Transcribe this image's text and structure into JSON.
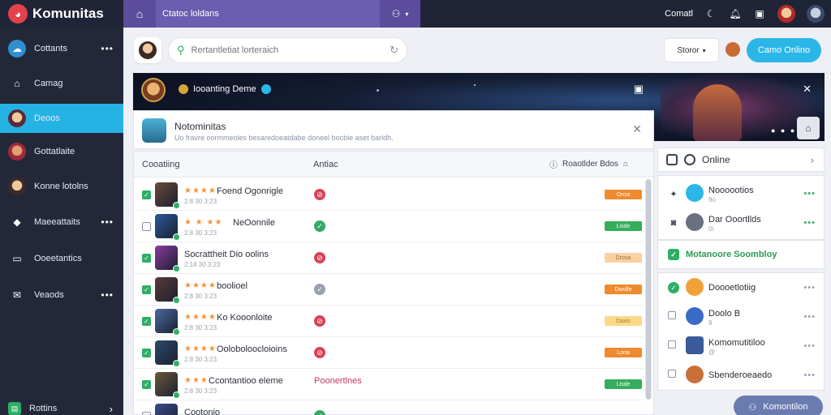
{
  "app": {
    "brand": "Komunitas"
  },
  "topbar": {
    "breadcrumb": "Ctatoc loldans",
    "right_label": "Comatl"
  },
  "sidebar": {
    "items": [
      {
        "label": "Cottants",
        "icon": "community-icon",
        "more": true
      },
      {
        "label": "Camag",
        "icon": "home-icon",
        "more": false
      },
      {
        "label": "Deoos",
        "icon": "user-avatar-icon",
        "more": false,
        "active": true
      },
      {
        "label": "Gottatlaite",
        "icon": "game-avatar-icon",
        "more": false
      },
      {
        "label": "Konne lotolns",
        "icon": "profile-icon",
        "more": false
      },
      {
        "label": "Maeeattaits",
        "icon": "gamepad-icon",
        "more": true
      },
      {
        "label": "Ooeetantics",
        "icon": "chat-icon",
        "more": false
      },
      {
        "label": "Veaods",
        "icon": "mail-icon",
        "more": true
      }
    ],
    "footer_label": "Rottins"
  },
  "search": {
    "placeholder": "Rertantletiat lorteraich"
  },
  "status_select": {
    "value": "Storor"
  },
  "cta_label": "Camo Onlino",
  "banner": {
    "title": "Iooanting Deme"
  },
  "notice": {
    "title": "Notominitas",
    "subtitle": "Uo fravre oormmeoles besaredoeatdabe doneel bocbie aset barldh."
  },
  "table": {
    "headers": {
      "col1": "Cooatiing",
      "col2": "Antiac",
      "col3": "Roaotlder Bdos"
    },
    "rows": [
      {
        "checked": true,
        "stars": "★★★★",
        "title": "Foend Ogonrigle",
        "sub": "2:8 30 3:23",
        "action": "red",
        "tag": "Orcia",
        "tag_color": "orange",
        "thumb": "#6a4a3a"
      },
      {
        "checked": false,
        "stars": "★ ★ ★★",
        "title": "NeOonnile",
        "sub": "2:8 30 3:23",
        "action": "green",
        "tag": "Lisde",
        "tag_color": "green",
        "thumb": "#2a5a9a"
      },
      {
        "checked": true,
        "stars": "",
        "title": "Socrattheit Dio oolins",
        "sub": "2:18 30 3:23",
        "action": "red",
        "tag": "Drosa",
        "tag_color": "peach",
        "thumb": "#8a3aa0"
      },
      {
        "checked": true,
        "stars": "★★★★",
        "title": "boolioel",
        "sub": "2:8 30 3:23",
        "action": "gray",
        "tag": "Dwolle",
        "tag_color": "orange",
        "thumb": "#5a3a3a"
      },
      {
        "checked": true,
        "stars": "★★★★",
        "title": "Ko Kooonloite",
        "sub": "2:8 30 3:23",
        "action": "red",
        "tag": "Daxio",
        "tag_color": "yellow",
        "thumb": "#4a6aa0"
      },
      {
        "checked": true,
        "stars": "★★★★",
        "title": "Ooloboloocloioins",
        "sub": "2:8 30 3:23",
        "action": "red",
        "tag": "Loria",
        "tag_color": "orange",
        "thumb": "#2a4a6a"
      },
      {
        "checked": true,
        "stars": "★★★",
        "title": "Ccontantioo eleme",
        "sub": "2:8 30 3:23",
        "action": "green",
        "tag": "Lisde",
        "tag_color": "green",
        "thumb": "#6a5a3a",
        "extra": "Poonertlnes"
      },
      {
        "checked": false,
        "stars": "",
        "title": "Cootonio",
        "sub": "",
        "action": "green",
        "tag": "",
        "tag_color": "green",
        "thumb": "#3a4a8a"
      }
    ]
  },
  "right_panel": {
    "header": "Online",
    "online": [
      {
        "name": "Noooootios",
        "meta": "9o",
        "avatar": "#2bb6e8"
      },
      {
        "name": "Dar Ooortllds",
        "meta": "0i",
        "avatar": "#6a7080"
      }
    ],
    "green_bar": "Motanoore Soombloy",
    "list": [
      {
        "name": "Doooetlotiig",
        "avatar": "#f0a23a",
        "checked": true
      },
      {
        "name": "Doolo B",
        "meta": "9",
        "avatar": "#3a6ac8",
        "checked": false
      },
      {
        "name": "Komomutitiloo",
        "meta": "@",
        "avatar": "#3a5a9a",
        "checked": false
      },
      {
        "name": "Sbenderoeaedo",
        "avatar": "#c8703a",
        "checked": false
      }
    ]
  },
  "chat_button": "Komontilon"
}
